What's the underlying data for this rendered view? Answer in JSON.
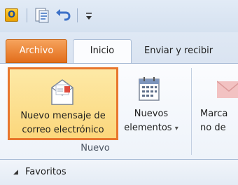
{
  "quick_access": {
    "app_icon_letter": "O",
    "icons": [
      "outlook-app-icon",
      "send-receive-icon",
      "undo-icon",
      "customize-toolbar-icon"
    ]
  },
  "tabs": [
    {
      "label": "Archivo"
    },
    {
      "label": "Inicio"
    },
    {
      "label": "Enviar y recibir"
    }
  ],
  "ribbon": {
    "nuevo_mensaje": {
      "line1": "Nuevo mensaje de",
      "line2": "correo electrónico"
    },
    "nuevos_elementos": {
      "line1": "Nuevos",
      "line2": "elementos",
      "arrow": "▾"
    },
    "marcar": {
      "line1": "Marca",
      "line2": "no de"
    },
    "group_label": "Nuevo"
  },
  "nav": {
    "collapse_glyph": "◢",
    "favoritos": "Favoritos"
  },
  "colors": {
    "accent_orange": "#e8762d",
    "archivo_tab": "#e26d1b",
    "highlight_fill": "#fcd77c",
    "ribbon_bg": "#f6f9fd"
  }
}
